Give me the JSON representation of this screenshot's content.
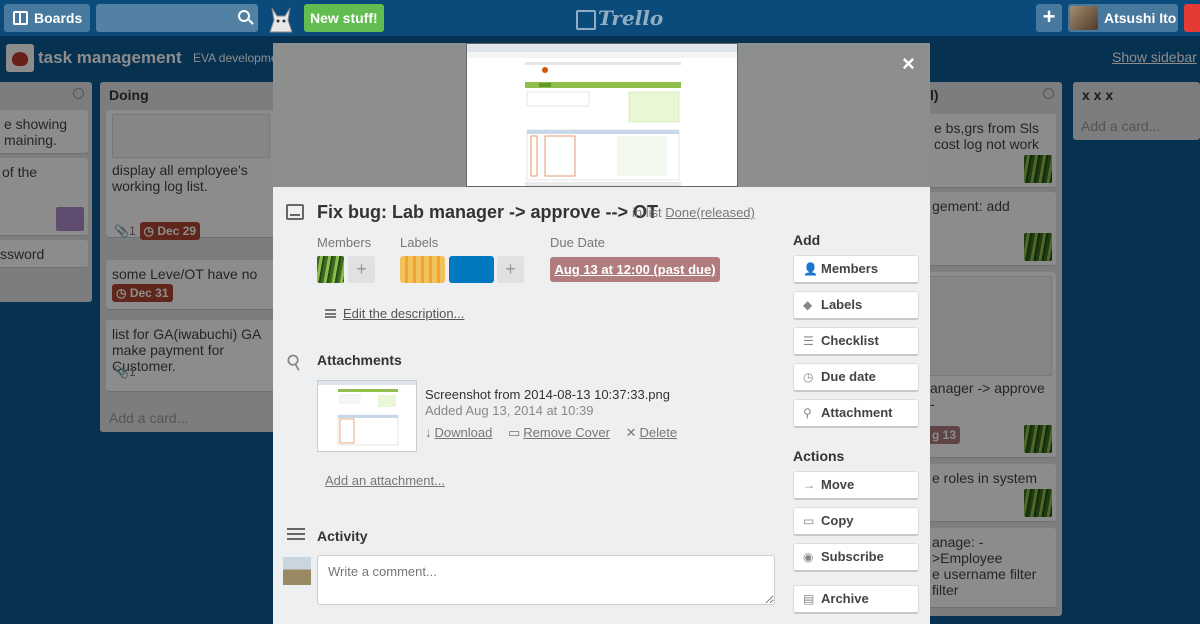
{
  "header": {
    "boards_label": "Boards",
    "new_stuff_label": "New stuff!",
    "logo_text": "Trello",
    "plus_label": "+",
    "user_name": "Atsushi Ito"
  },
  "board": {
    "title": "task management",
    "org": "EVA development",
    "show_sidebar": "Show sidebar"
  },
  "lists": {
    "left": {
      "cards": [
        {
          "text": "e showing\nmaining."
        },
        {
          "text": "of the"
        },
        {
          "text": "ssword"
        }
      ]
    },
    "doing": {
      "title": "Doing",
      "cards": [
        {
          "text": "display all employee's working log list.",
          "attach_count": "1",
          "due": "Dec 29"
        },
        {
          "text": "some Leve/OT have no dept",
          "due": "Dec 31"
        },
        {
          "text": "list for GA(iwabuchi) GA make payment for Customer.",
          "attach_count": "1"
        }
      ],
      "add_card": "Add a card..."
    },
    "done": {
      "title_fragment": "l)",
      "cards": [
        {
          "text": "e bs,grs from Sls\n cost log not work"
        },
        {
          "text": "gement: add"
        },
        {
          "text": "anager -> approve -",
          "due_fragment": "g 13"
        },
        {
          "text": "e roles in system"
        },
        {
          "text": "anage: ->Employee\ne username filter\nfilter"
        }
      ]
    },
    "xxx": {
      "title": "x x x",
      "add_card": "Add a card..."
    }
  },
  "modal": {
    "close": "×",
    "title": "Fix bug: Lab manager -> approve --> OT",
    "in_list_prefix": "in list",
    "list_name": "Done(released)",
    "members_label": "Members",
    "labels_label": "Labels",
    "due_date_label": "Due Date",
    "due_date_value": "Aug 13 at 12:00 (past due)",
    "add_plus": "+",
    "edit_description": "Edit the description...",
    "attachments_title": "Attachments",
    "attachment": {
      "filename": "Screenshot from 2014-08-13 10:37:33.png",
      "added": "Added Aug 13, 2014 at 10:39",
      "download": "Download",
      "remove_cover": "Remove Cover",
      "delete": "Delete"
    },
    "add_attachment": "Add an attachment...",
    "activity_title": "Activity",
    "comment_placeholder": "Write a comment..."
  },
  "sidebar": {
    "add_title": "Add",
    "add_buttons": [
      {
        "label": "Members",
        "icon": "person-icon"
      },
      {
        "label": "Labels",
        "icon": "tag-icon"
      },
      {
        "label": "Checklist",
        "icon": "checklist-icon"
      },
      {
        "label": "Due date",
        "icon": "clock-icon"
      },
      {
        "label": "Attachment",
        "icon": "paperclip-icon"
      }
    ],
    "actions_title": "Actions",
    "action_buttons": [
      {
        "label": "Move",
        "icon": "arrow-right-icon"
      },
      {
        "label": "Copy",
        "icon": "copy-icon"
      },
      {
        "label": "Subscribe",
        "icon": "eye-icon"
      },
      {
        "label": "Archive",
        "icon": "archive-icon"
      }
    ]
  },
  "colors": {
    "header_bg": "#0a4b7c",
    "board_bg": "#0d5a94",
    "new_stuff": "#61bd4f",
    "label_orange": "#f7a232",
    "label_blue": "#0079bf",
    "due_past": "#b07c7e",
    "badge_red": "#b04632"
  }
}
